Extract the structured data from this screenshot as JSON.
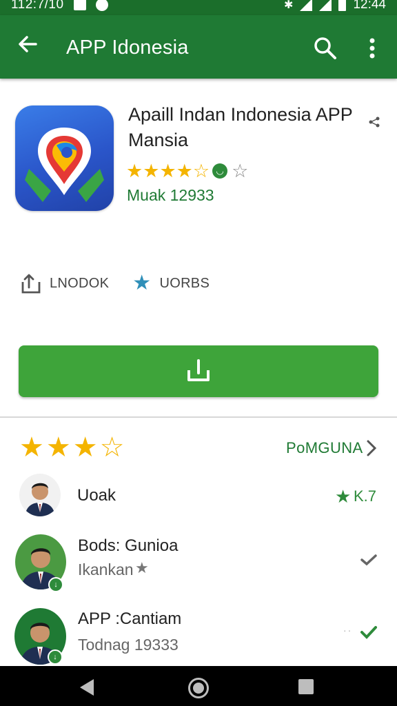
{
  "status_bar": {
    "time": "112:7/10",
    "clock_right": "12:44"
  },
  "app_bar": {
    "title": "APP Idonesia"
  },
  "app": {
    "title": "Apaill Indan Indonesia APP Mansia",
    "developer_line": "Muak 12933",
    "rating": 3.5
  },
  "actions": [
    {
      "label": "LNODOK",
      "icon": "share-icon"
    },
    {
      "label": "UORBS",
      "icon": "star-icon"
    }
  ],
  "install": {
    "icon": "download-icon",
    "color": "#3ea43a"
  },
  "ratings_section": {
    "stars": 3.5,
    "link": "PoMGUNA"
  },
  "users": [
    {
      "name": "Uoak",
      "sub": "",
      "right": "K.7",
      "right_icon": "star-icon"
    },
    {
      "name": "Bods: Gunioa",
      "sub": "Ikankan",
      "right_icon": "check-icon"
    },
    {
      "name": "APP :Cantiam",
      "sub": "Todnag 19333",
      "right_icon": "check-icon"
    }
  ],
  "colors": {
    "app_bar": "#1f7a34",
    "status_bar": "#1b6e2b",
    "accent": "#1f7a34",
    "star": "#f4b400"
  }
}
